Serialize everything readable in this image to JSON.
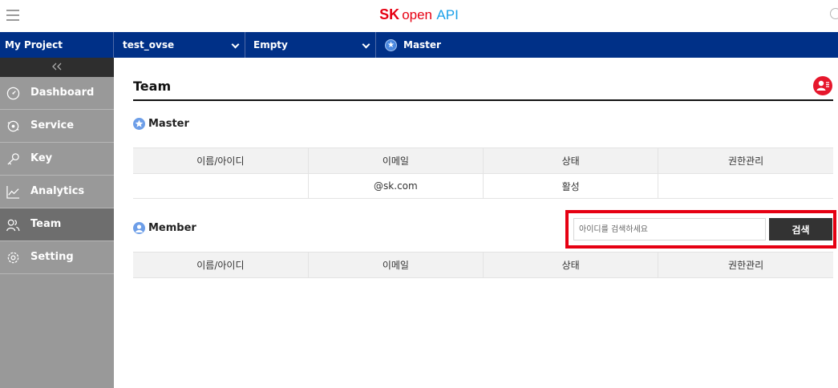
{
  "header": {
    "logo_sk": "SK",
    "logo_open": "open",
    "logo_api": "API"
  },
  "nav": {
    "project_label": "My Project",
    "service_select": "test_ovse",
    "env_select": "Empty",
    "role": "Master"
  },
  "sidebar": {
    "items": [
      {
        "label": "Dashboard",
        "icon": "dashboard-icon"
      },
      {
        "label": "Service",
        "icon": "service-icon"
      },
      {
        "label": "Key",
        "icon": "key-icon"
      },
      {
        "label": "Analytics",
        "icon": "analytics-icon"
      },
      {
        "label": "Team",
        "icon": "team-icon",
        "active": true
      },
      {
        "label": "Setting",
        "icon": "gear-icon"
      }
    ]
  },
  "page": {
    "title": "Team",
    "master_section": "Master",
    "member_section": "Member"
  },
  "table_headers": [
    "이름/아이디",
    "이메일",
    "상태",
    "권한관리"
  ],
  "master_row": [
    "",
    "@sk.com",
    "활성",
    ""
  ],
  "search": {
    "placeholder": "아이디를 검색하세요",
    "button": "검색"
  },
  "colors": {
    "nav_bg": "#003087",
    "accent_red": "#e60012",
    "sidebar_bg": "#999999",
    "sidebar_active": "#6e6e6e"
  }
}
